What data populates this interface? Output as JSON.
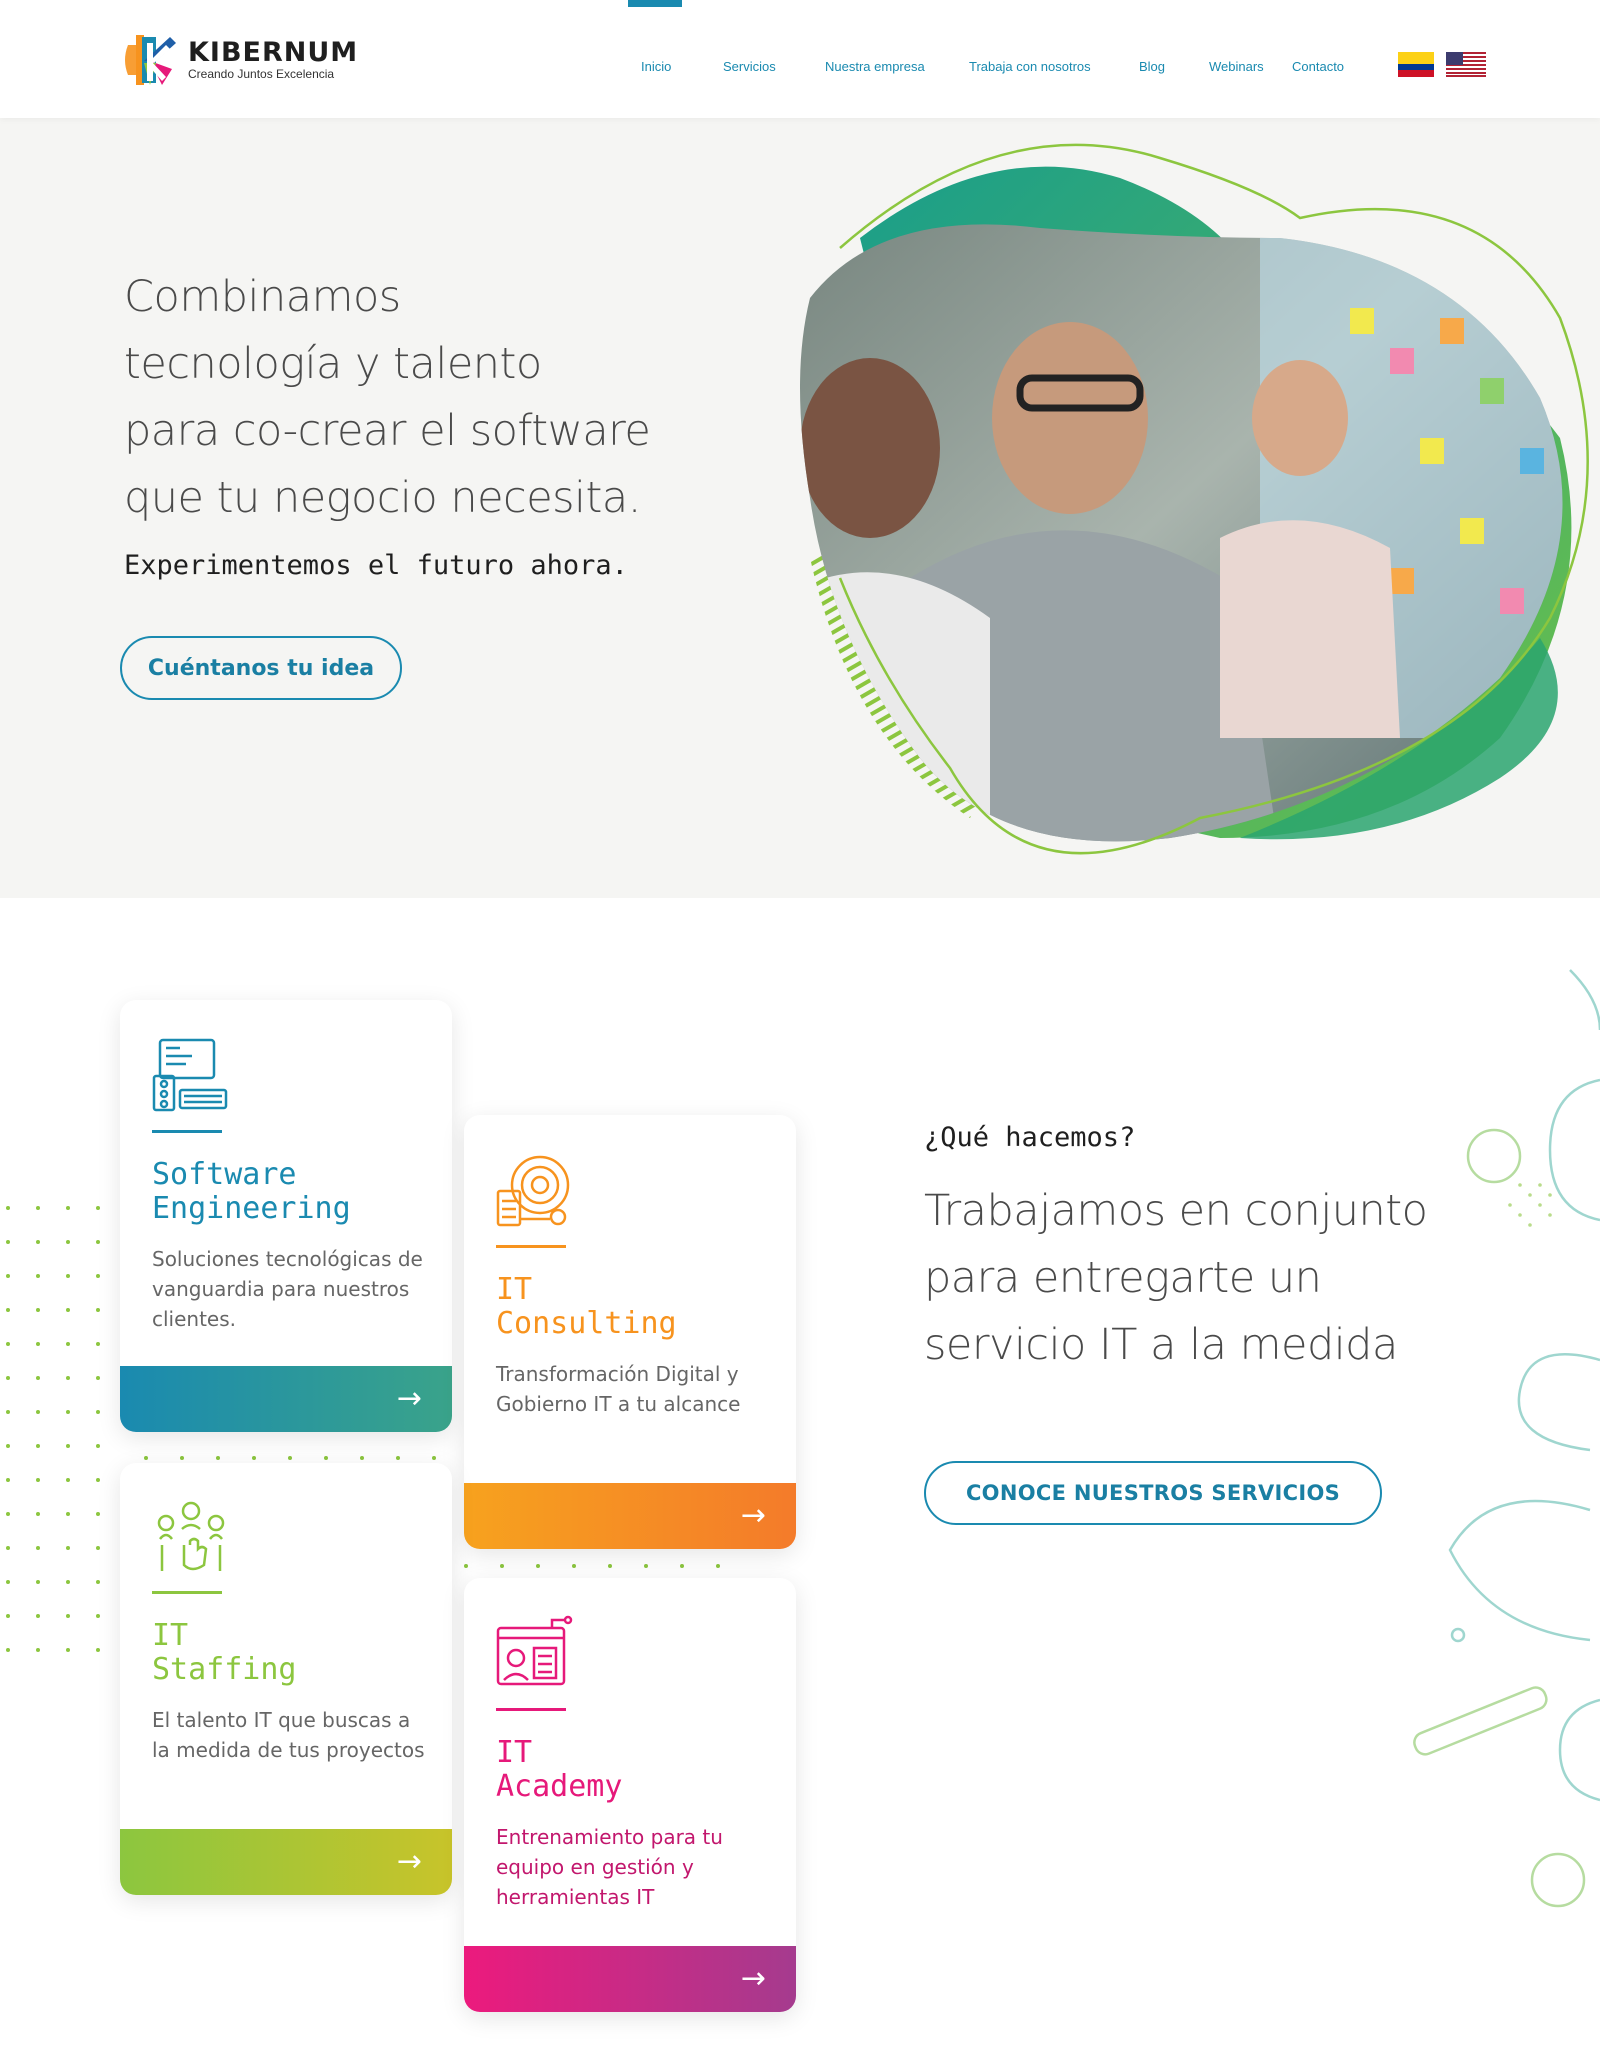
{
  "header": {
    "logo_name": "KIBERNUM",
    "logo_tagline": "Creando Juntos Excelencia",
    "nav": [
      {
        "label": "Inicio",
        "active": true
      },
      {
        "label": "Servicios",
        "active": false
      },
      {
        "label": "Nuestra empresa",
        "active": false
      },
      {
        "label": "Trabaja con nosotros",
        "active": false
      },
      {
        "label": "Blog",
        "active": false
      },
      {
        "label": "Webinars",
        "active": false
      },
      {
        "label": "Contacto",
        "active": false
      }
    ],
    "languages": [
      "colombia-flag-icon",
      "usa-flag-icon"
    ]
  },
  "hero": {
    "title_lines": [
      "Combinamos",
      "tecnología y talento",
      "para co-crear el software",
      "que tu negocio necesita."
    ],
    "subtitle": "Experimentemos el futuro ahora.",
    "cta_label": "Cuéntanos tu idea"
  },
  "services": {
    "cards": [
      {
        "title_lines": [
          "Software",
          "Engineering"
        ],
        "description": "Soluciones tecnológicas de vanguardia para nuestros clientes.",
        "color": "#1a8ab0",
        "icon": "software-engineering-icon"
      },
      {
        "title_lines": [
          "IT",
          "Consulting"
        ],
        "description": "Transformación Digital y Gobierno IT a tu alcance",
        "color": "#f7931e",
        "icon": "it-consulting-icon"
      },
      {
        "title_lines": [
          "IT",
          "Staffing"
        ],
        "description": "El talento IT que buscas a la medida de tus proyectos",
        "color": "#8cc63f",
        "icon": "it-staffing-icon"
      },
      {
        "title_lines": [
          "IT",
          "Academy"
        ],
        "description": "Entrenamiento para tu equipo en gestión y herramientas IT",
        "color": "#e6197a",
        "icon": "it-academy-icon"
      }
    ],
    "section_label": "¿Qué hacemos?",
    "section_title_lines": [
      "Trabajamos en conjunto",
      "para entregarte un",
      "servicio IT  a la medida"
    ],
    "section_cta": "CONOCE NUESTROS SERVICIOS",
    "arrow": "→"
  }
}
